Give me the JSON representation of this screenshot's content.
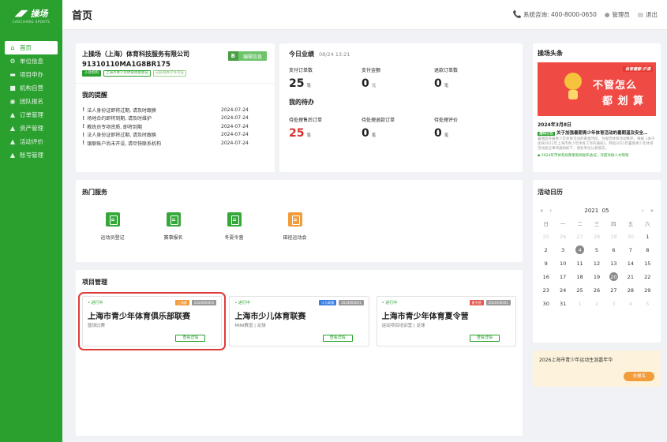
{
  "brand": {
    "name": "操场",
    "sub": "CAOCHANG SPORTS"
  },
  "nav": [
    {
      "label": "首页",
      "icon": "home-icon",
      "glyph": "⌂",
      "active": true
    },
    {
      "label": "单位信息",
      "icon": "building-icon",
      "glyph": "⚙"
    },
    {
      "label": "项目申办",
      "icon": "folder-icon",
      "glyph": "▬"
    },
    {
      "label": "机构自营",
      "icon": "store-icon",
      "glyph": "■"
    },
    {
      "label": "团队报名",
      "icon": "team-icon",
      "glyph": "◉"
    },
    {
      "label": "订单管理",
      "icon": "thumb-icon",
      "glyph": "▲"
    },
    {
      "label": "资产管理",
      "icon": "thumb-icon",
      "glyph": "▲"
    },
    {
      "label": "活动评价",
      "icon": "thumb-icon",
      "glyph": "▲"
    },
    {
      "label": "账号管理",
      "icon": "thumb-icon",
      "glyph": "▲"
    }
  ],
  "header": {
    "title": "首页",
    "hotline": "系统咨询: 400-8000-0650",
    "user": "管理员",
    "logout": "退出"
  },
  "company": {
    "name": "上操场（上海）体育科技服务有限公司",
    "code": "91310110MA1G8BR175",
    "tags": [
      "入驻机构",
      "上海市青少年体育协会会员",
      "已获得办学许可证"
    ],
    "info_button": "B",
    "info_label": "编辑信息"
  },
  "reminders": {
    "title": "我的提醒",
    "items": [
      {
        "text": "法人身份证即将过期, 请及时跟换",
        "date": "2024-07-24"
      },
      {
        "text": "场地合约即将到期, 请及时维护",
        "date": "2024-07-24"
      },
      {
        "text": "教练员专项资质, 即将到期",
        "date": "2024-07-24"
      },
      {
        "text": "法人身份证即将过期, 请及时跟换",
        "date": "2024-07-24"
      },
      {
        "text": "银联账户尚未开设, 请尽快联系机构",
        "date": "2024-07-24"
      }
    ]
  },
  "performance": {
    "title": "今日业绩",
    "time": "08/24 13:21",
    "stats": [
      {
        "label": "支付订单数",
        "value": "25",
        "unit": "笔"
      },
      {
        "label": "支付金额",
        "value": "0",
        "unit": "元"
      },
      {
        "label": "退款订单数",
        "value": "0",
        "unit": "笔"
      }
    ]
  },
  "todo": {
    "title": "我的待办",
    "stats": [
      {
        "label": "待处理售后订单",
        "value": "25",
        "unit": "笔",
        "red": true
      },
      {
        "label": "待处理退款订单",
        "value": "0",
        "unit": "笔"
      },
      {
        "label": "待处理评价",
        "value": "0",
        "unit": "笔"
      }
    ]
  },
  "services": {
    "title": "热门服务",
    "items": [
      {
        "label": "运动员登记",
        "color": "green"
      },
      {
        "label": "赛事报名",
        "color": "green"
      },
      {
        "label": "冬夏令营",
        "color": "green"
      },
      {
        "label": "田径运动会",
        "color": "orange"
      }
    ]
  },
  "projects": {
    "title": "项目管理",
    "items": [
      {
        "status": "• 进行中",
        "badges": [
          {
            "t": "上海赛",
            "c": "org"
          },
          {
            "t": "2024000001",
            "c": "gr"
          }
        ],
        "name": "上海市青少年体育俱乐部联赛",
        "sub": "篮球比赛",
        "btn": "查看详情",
        "selected": true
      },
      {
        "status": "• 进行中",
        "badges": [
          {
            "t": "少儿联赛",
            "c": "blu"
          },
          {
            "t": "2024000001",
            "c": "gr"
          }
        ],
        "name": "上海市少儿体育联赛",
        "sub": "MINI赛道 | 足球",
        "btn": "查看详情"
      },
      {
        "status": "• 进行中",
        "badges": [
          {
            "t": "夏令营",
            "c": "red"
          },
          {
            "t": "2024000001",
            "c": "gr"
          }
        ],
        "name": "上海市青少年体育夏令营",
        "sub": "运动项目培训营 | 足球",
        "btn": "查看详情"
      }
    ]
  },
  "news": {
    "title": "操场头条",
    "banner_tag": "体育健都·沪滇",
    "banner_line1": "不管怎么",
    "banner_line2": "都 划 算",
    "date": "2024年3月8日",
    "tag": "通知公告",
    "headline": "关于加强暑期青少年体育活动的暑期温及安全…",
    "body": "暑期是开展青少年体育活动的黄金时段，为规范体育活动秩序，根据《关于加快2021年上海市青少年体育工作的通知》，特就2021年暑期青少年体育活动安全事项通知如下，请各单位认真落实。",
    "foot": "◆ 2024年市体育局政策新闻发布会议，深度对接人才政策"
  },
  "calendar": {
    "title": "活动日历",
    "year": "2021",
    "month": "05",
    "nav_prev_year": "«",
    "nav_prev": "‹",
    "nav_next": "›",
    "nav_next_year": "»",
    "weekdays": [
      "日",
      "一",
      "二",
      "三",
      "四",
      "五",
      "六"
    ],
    "days": [
      {
        "d": "25",
        "off": true
      },
      {
        "d": "26",
        "off": true
      },
      {
        "d": "27",
        "off": true
      },
      {
        "d": "28",
        "off": true
      },
      {
        "d": "29",
        "off": true
      },
      {
        "d": "30",
        "off": true
      },
      {
        "d": "1"
      },
      {
        "d": "2"
      },
      {
        "d": "3"
      },
      {
        "d": "4",
        "sel": true
      },
      {
        "d": "5"
      },
      {
        "d": "6"
      },
      {
        "d": "7"
      },
      {
        "d": "8"
      },
      {
        "d": "9"
      },
      {
        "d": "10"
      },
      {
        "d": "11"
      },
      {
        "d": "12"
      },
      {
        "d": "13"
      },
      {
        "d": "14"
      },
      {
        "d": "15"
      },
      {
        "d": "16"
      },
      {
        "d": "17"
      },
      {
        "d": "18"
      },
      {
        "d": "19"
      },
      {
        "d": "20",
        "sel": true
      },
      {
        "d": "21"
      },
      {
        "d": "22"
      },
      {
        "d": "23"
      },
      {
        "d": "24"
      },
      {
        "d": "25"
      },
      {
        "d": "26"
      },
      {
        "d": "27"
      },
      {
        "d": "28"
      },
      {
        "d": "29"
      },
      {
        "d": "30"
      },
      {
        "d": "31"
      },
      {
        "d": "1",
        "off": true
      },
      {
        "d": "2",
        "off": true
      },
      {
        "d": "3",
        "off": true
      },
      {
        "d": "4",
        "off": true
      },
      {
        "d": "5",
        "off": true
      }
    ]
  },
  "event": {
    "title": "2026上海市青少年运动生涯嘉年华",
    "button": "去报名"
  }
}
